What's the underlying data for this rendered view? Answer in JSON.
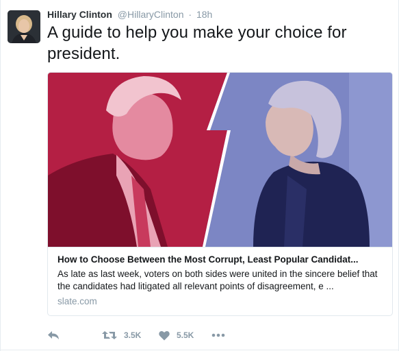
{
  "tweet": {
    "author_name": "Hillary Clinton",
    "handle": "@HillaryClinton",
    "separator": "·",
    "time": "18h",
    "text": "A guide to help you make your choice for president."
  },
  "card": {
    "title": "How to Choose Between the Most Corrupt, Least Popular Candidat...",
    "description": "As late as last week, voters on both sides were united in the sincere belief that the candidates had litigated all relevant points of disagreement, e ...",
    "domain": "slate.com"
  },
  "actions": {
    "reply_icon": "reply-icon",
    "retweet_icon": "retweet-icon",
    "retweet_count": "3.5K",
    "like_icon": "heart-icon",
    "like_count": "5.5K",
    "more_icon": "more-icon"
  },
  "colors": {
    "card_left_red": "#b41f44",
    "card_right_blue": "#7c86c4",
    "text_primary": "#14171a",
    "text_secondary": "#8899a6"
  }
}
